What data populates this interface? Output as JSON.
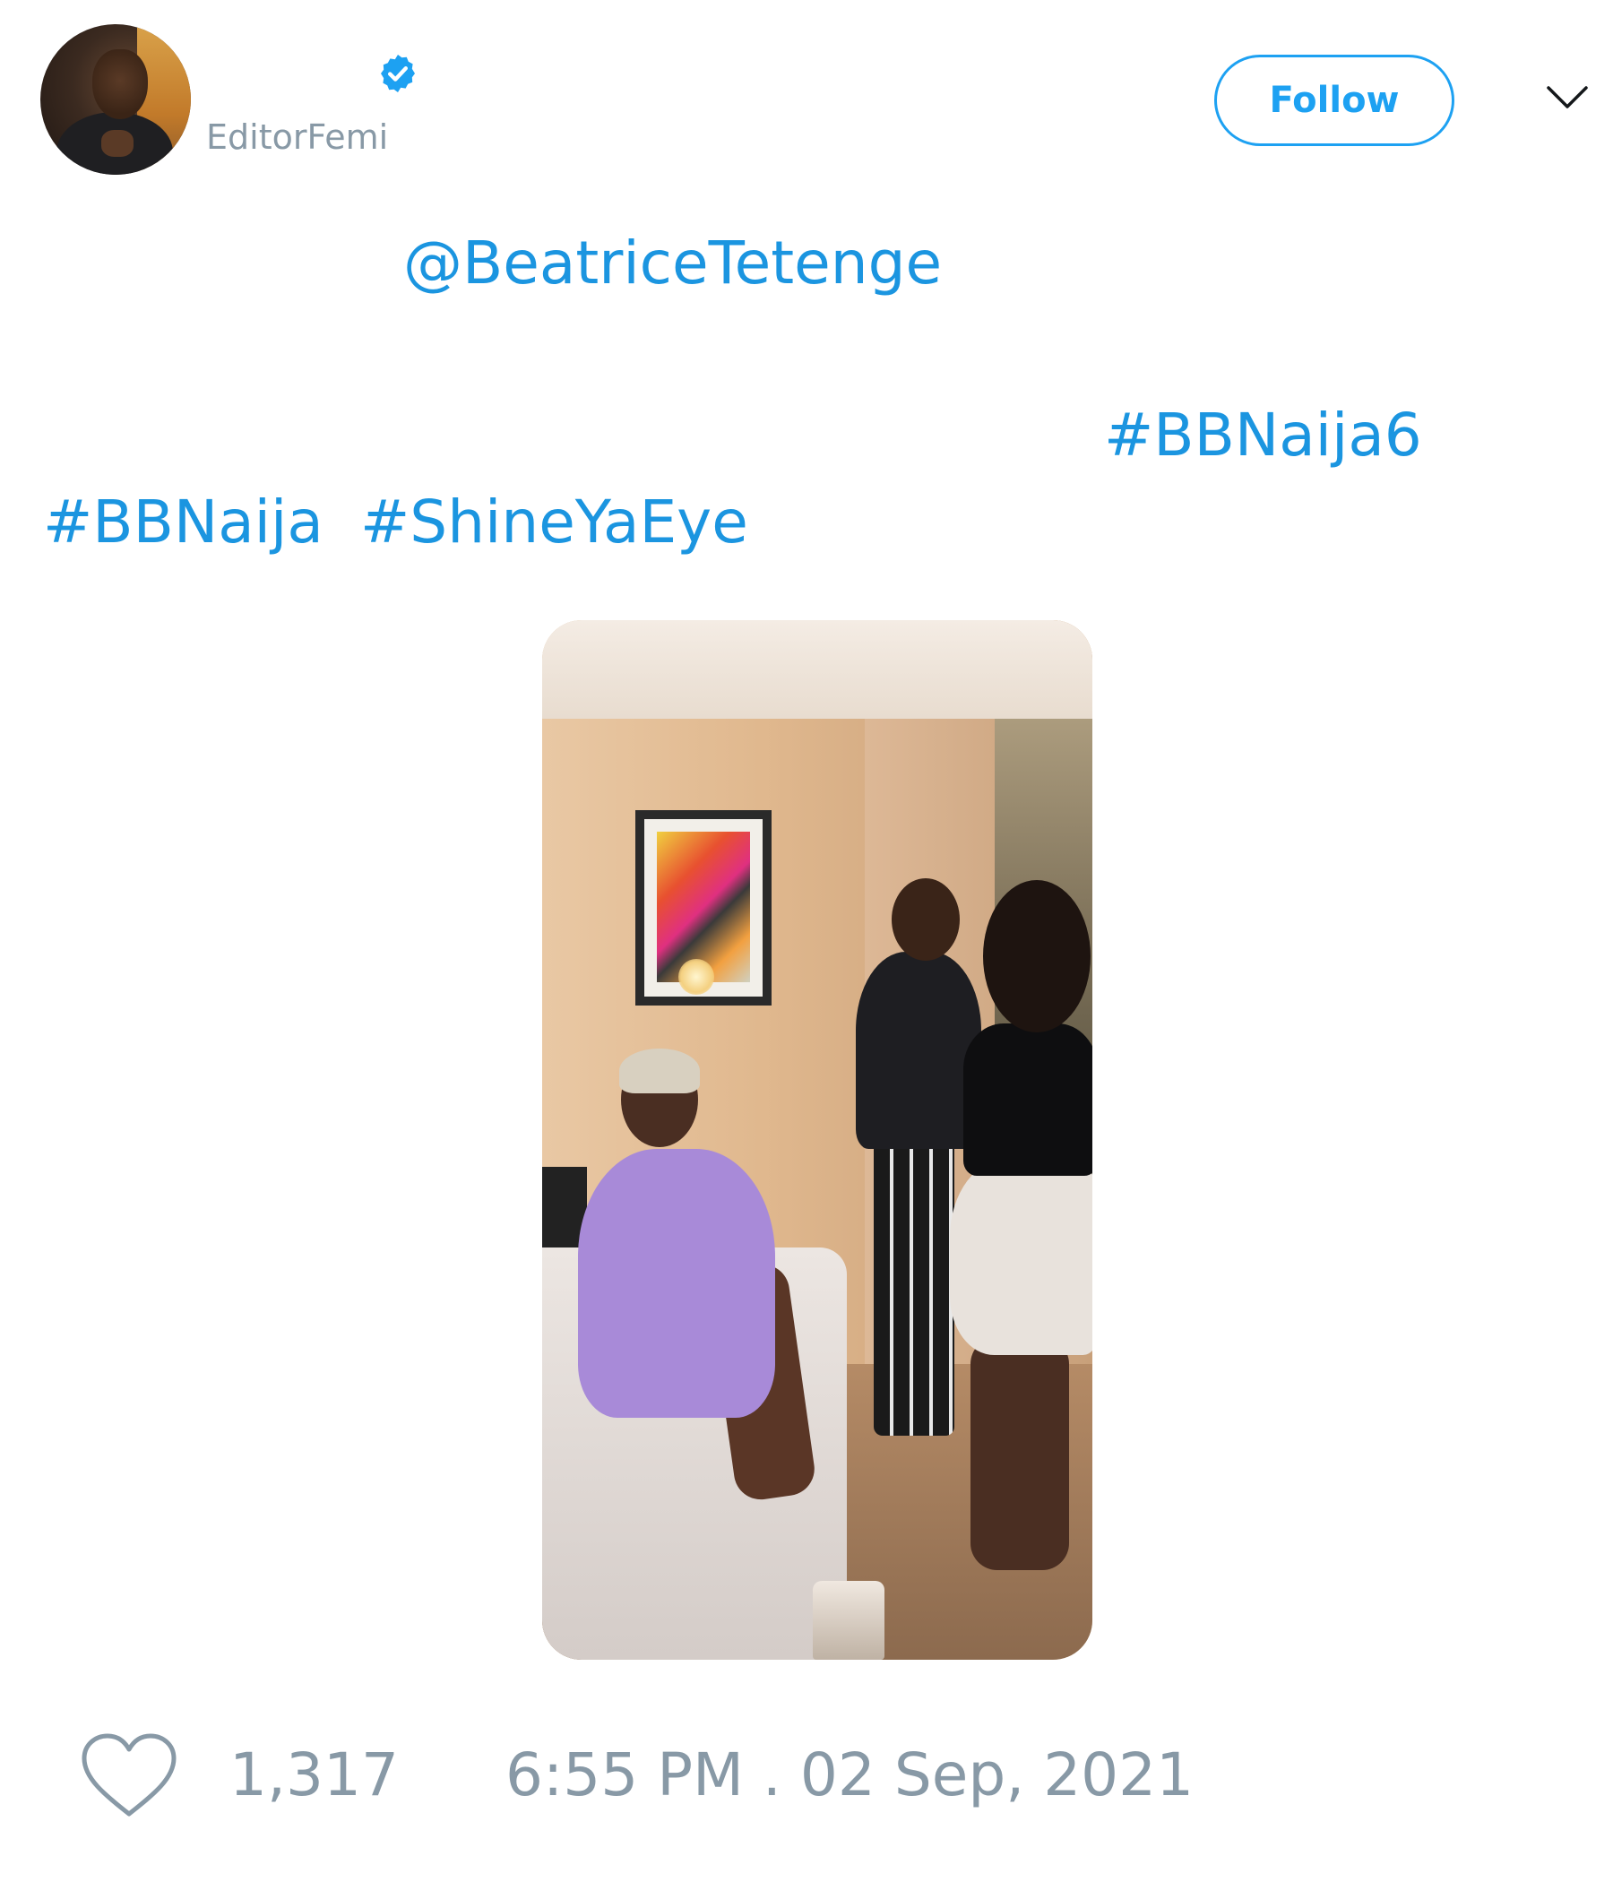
{
  "author": {
    "display_name": "",
    "username": "EditorFemi",
    "verified": true,
    "follow_label": "Follow"
  },
  "tweet": {
    "mention": "@BeatriceTetenge",
    "hashtags": [
      "#BBNaija6",
      "#BBNaija",
      "#ShineYaEye"
    ]
  },
  "footer": {
    "like_count": "1,317",
    "timestamp": "6:55 PM . 02 Sep, 2021"
  },
  "colors": {
    "accent": "#1da1f2",
    "link": "#1b95e0",
    "muted": "#8899a6"
  },
  "icons": {
    "verified": "verified-badge-icon",
    "menu": "chevron-down-icon",
    "like": "heart-icon"
  }
}
